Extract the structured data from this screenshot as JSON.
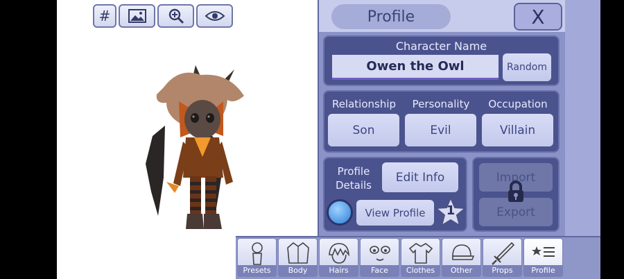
{
  "header": {
    "title": "Profile",
    "close_label": "X"
  },
  "toolbar": [
    {
      "name": "grid-icon",
      "glyph": "#"
    },
    {
      "name": "background-image-icon"
    },
    {
      "name": "zoom-icon"
    },
    {
      "name": "eye-icon"
    }
  ],
  "character_name": {
    "label": "Character Name",
    "value": "Owen the Owl",
    "random_label": "Random"
  },
  "traits": {
    "relationship": {
      "label": "Relationship",
      "value": "Son"
    },
    "personality": {
      "label": "Personality",
      "value": "Evil"
    },
    "occupation": {
      "label": "Occupation",
      "value": "Villain"
    }
  },
  "profile_details": {
    "label_line1": "Profile",
    "label_line2": "Details",
    "edit_label": "Edit Info",
    "view_label": "View Profile",
    "star_number": "1"
  },
  "io": {
    "import_label": "Import",
    "export_label": "Export",
    "locked": true
  },
  "tabs": [
    {
      "label": "Presets",
      "icon": "preset-figure-icon"
    },
    {
      "label": "Body",
      "icon": "body-jacket-icon"
    },
    {
      "label": "Hairs",
      "icon": "hair-icon"
    },
    {
      "label": "Face",
      "icon": "face-icon"
    },
    {
      "label": "Clothes",
      "icon": "shirt-icon"
    },
    {
      "label": "Other",
      "icon": "cap-icon"
    },
    {
      "label": "Props",
      "icon": "sword-icon"
    },
    {
      "label": "Profile",
      "icon": "star-list-icon",
      "active": true
    }
  ]
}
